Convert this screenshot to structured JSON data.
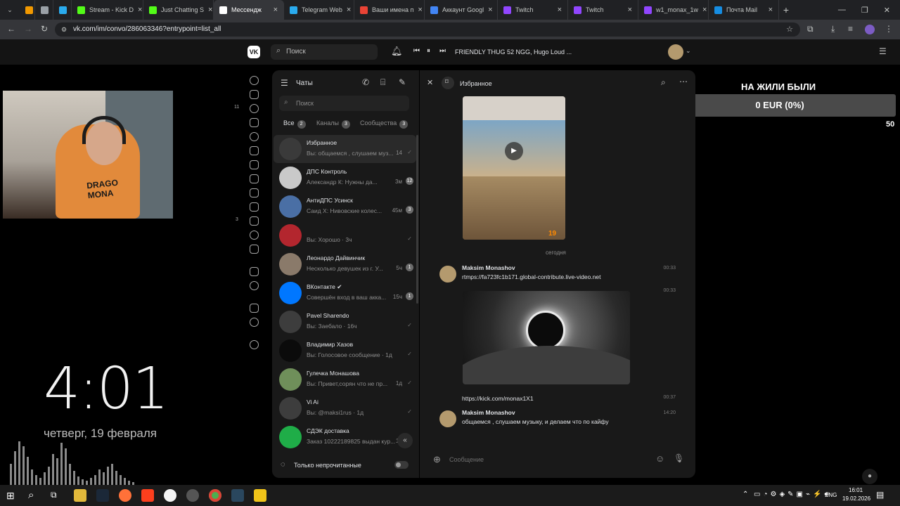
{
  "browser": {
    "tabs": [
      {
        "label": "",
        "color": "#f29900"
      },
      {
        "label": "",
        "color": "#9aa0a6"
      },
      {
        "label": "",
        "color": "#2aabee"
      },
      {
        "label": "Stream - Kick D",
        "color": "#53fc18"
      },
      {
        "label": "Just Chatting S",
        "color": "#53fc18"
      },
      {
        "label": "Мессендж",
        "color": "#ffffff"
      },
      {
        "label": "Telegram Web",
        "color": "#2aabee"
      },
      {
        "label": "Ваши имена п",
        "color": "#ea4335"
      },
      {
        "label": "Аккаунт Googl",
        "color": "#4285f4"
      },
      {
        "label": "Twitch",
        "color": "#9146ff"
      },
      {
        "label": "Twitch",
        "color": "#9146ff"
      },
      {
        "label": "w1_monax_1w",
        "color": "#9146ff"
      },
      {
        "label": "Почта Mail",
        "color": "#168de2"
      }
    ],
    "url": "vk.com/im/convo/286063346?entrypoint=list_all"
  },
  "vk_header": {
    "search_placeholder": "Поиск",
    "now_playing": "FRIENDLY THUG 52 NGG, Hugo Loud ..."
  },
  "stream_overlay": {
    "clock": "4:01",
    "date": "четверг, 19 февраля",
    "goal_title": "НА ЖИЛИ БЫЛИ",
    "goal_amount": "0 EUR (0%)",
    "goal_min": "0",
    "goal_max": "50",
    "side_counter_1": "11",
    "side_counter_2": "3"
  },
  "chat_list": {
    "title": "Чаты",
    "search_placeholder": "Поиск",
    "tabs": [
      {
        "label": "Все",
        "count": "2"
      },
      {
        "label": "Каналы",
        "count": "3"
      },
      {
        "label": "Сообщества",
        "count": "3"
      }
    ],
    "chats": [
      {
        "name": "Избранное",
        "preview": "Вы: общаемся , слушаем муз...",
        "time": "14",
        "badge": "",
        "avatar_color": "#3a3a3a"
      },
      {
        "name": "ДПС Контроль",
        "preview": "Александр К: Нужны да...",
        "time": "3м",
        "badge": "12",
        "avatar_color": "#c9c9c9"
      },
      {
        "name": "АнтиДПС Усинск",
        "preview": "Саид Х: Нивовские колес...",
        "time": "45м",
        "badge": "3",
        "avatar_color": "#4a6fa5"
      },
      {
        "name": "",
        "preview": "Вы: Хорошо · 3ч",
        "time": "",
        "badge": "",
        "avatar_color": "#b3262e"
      },
      {
        "name": "Леонардо Дайвинчик",
        "preview": "Несколько девушек из г. У...",
        "time": "5ч",
        "badge": "1",
        "avatar_color": "#8a7a6a"
      },
      {
        "name": "ВКонтакте ✔",
        "preview": "Совершён вход в ваш акка...",
        "time": "15ч",
        "badge": "1",
        "avatar_color": "#0077ff"
      },
      {
        "name": "Pavel Sharendo",
        "preview": "Вы: Заебало · 16ч",
        "time": "",
        "badge": "",
        "avatar_color": "#3d3d3d"
      },
      {
        "name": "Владимир Хазов",
        "preview": "Вы: Голосовое сообщение · 1д",
        "time": "",
        "badge": "",
        "avatar_color": "#0b0b0b"
      },
      {
        "name": "Гулечка Монашова",
        "preview": "Вы: Привет,сорян что не пр...",
        "time": "1д",
        "badge": "",
        "avatar_color": "#6f8f5a"
      },
      {
        "name": "Vi Ai",
        "preview": "Вы: @maksi1rus · 1д",
        "time": "",
        "badge": "",
        "avatar_color": "#3d3d3d"
      },
      {
        "name": "СДЭК доставка",
        "preview": "Заказ 10222189825 выдан кур...",
        "time": "1д",
        "badge": "",
        "avatar_color": "#1fad48"
      }
    ],
    "unread_only_label": "Только непрочитанные"
  },
  "conversation": {
    "title": "Избранное",
    "day_separator": "сегодня",
    "messages": [
      {
        "author": "Maksim Monashov",
        "text": "rtmps://fa723fc1b171.global-contribute.live-video.net",
        "time": "00:33"
      },
      {
        "author": "",
        "text": "",
        "time": "00:33"
      },
      {
        "author": "",
        "text": "https://kick.com/monax1X1",
        "time": "00:37"
      },
      {
        "author": "Maksim Monashov",
        "text": "общаемся , слушаем музыку, и делаем что по кайфу",
        "time": "14:20"
      }
    ],
    "video_timer": "19",
    "input_placeholder": "Сообщение"
  },
  "taskbar": {
    "time": "16:01",
    "date": "19.02.2026",
    "lang": "ENG"
  }
}
